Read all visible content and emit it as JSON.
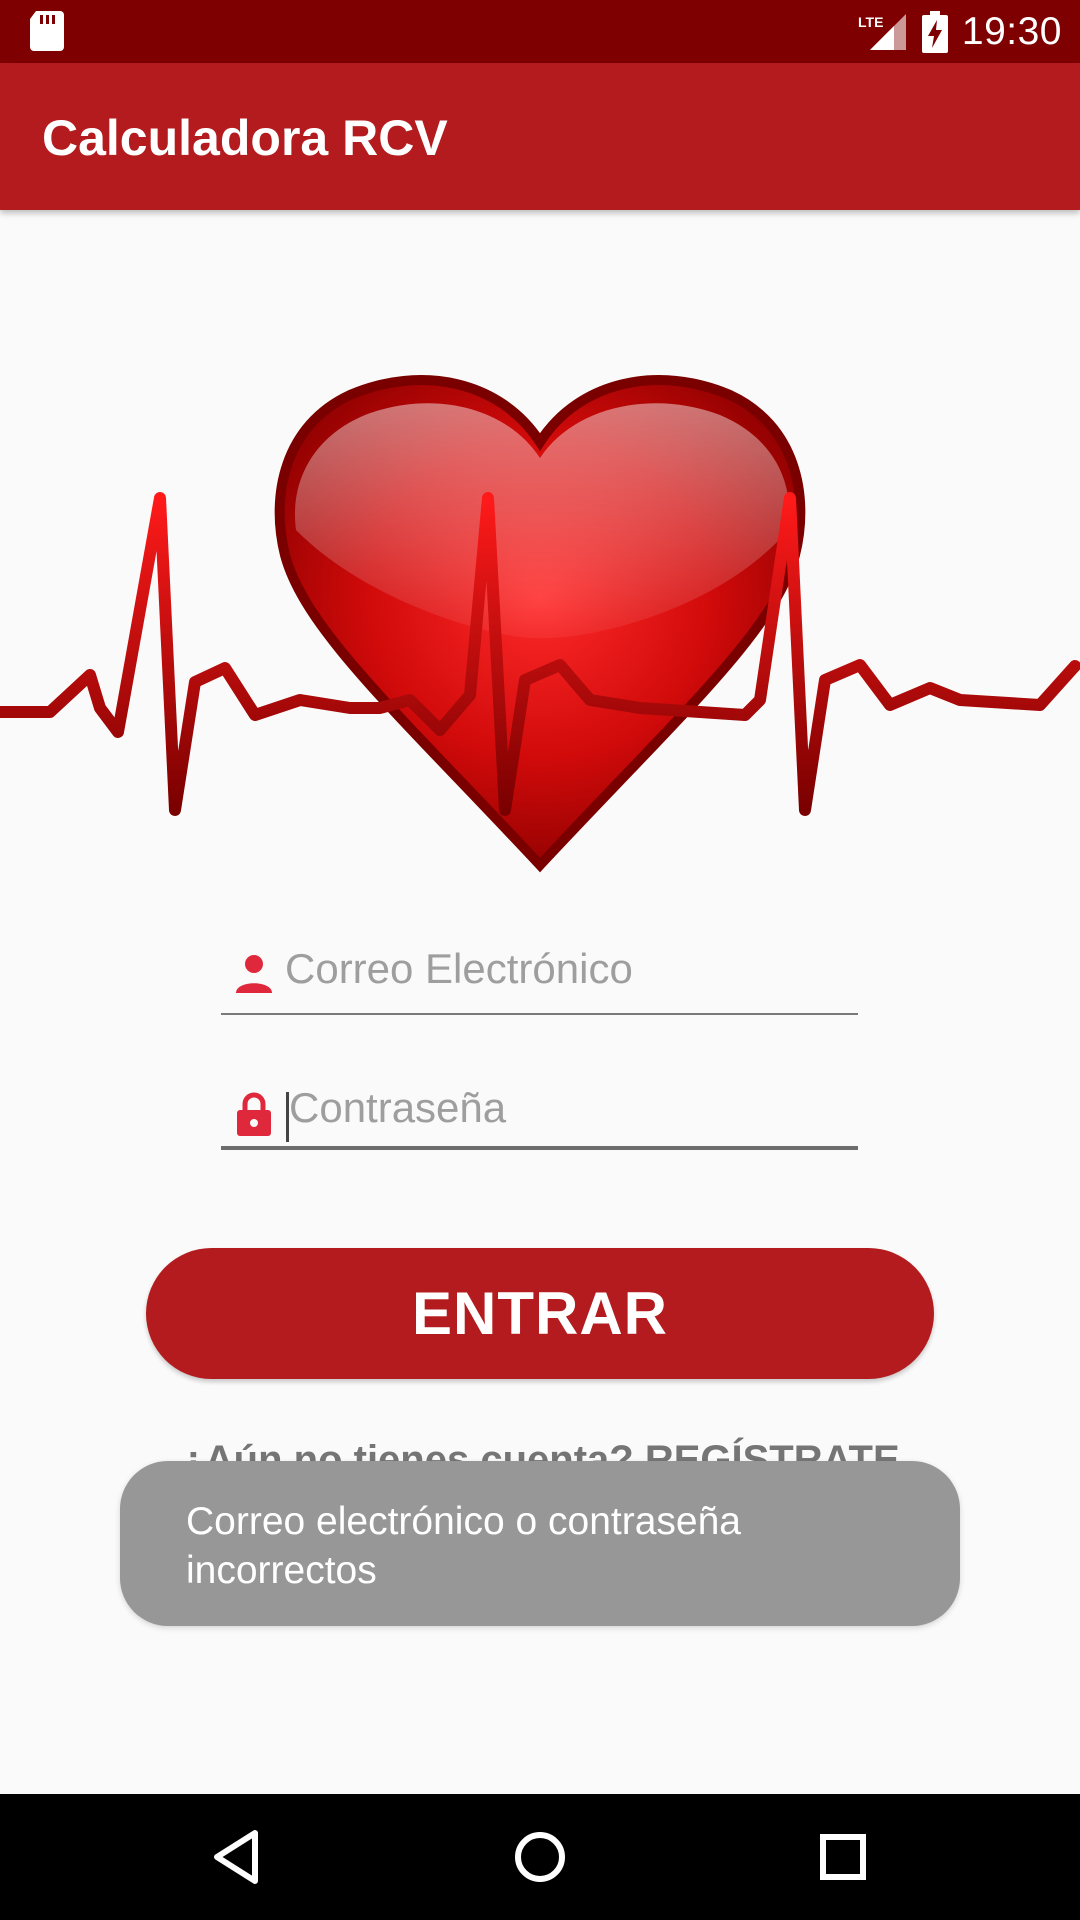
{
  "status_bar": {
    "time": "19:30",
    "network": "LTE",
    "icons": [
      "sd-card-icon",
      "lte-signal-icon",
      "battery-charging-icon"
    ]
  },
  "app_bar": {
    "title": "Calculadora RCV",
    "color": "#b31b1e"
  },
  "hero": {
    "image": "heart-ekg-icon"
  },
  "login_form": {
    "email": {
      "placeholder": "Correo Electrónico",
      "value": "",
      "icon": "person-icon"
    },
    "password": {
      "placeholder": "Contraseña",
      "value": "",
      "icon": "lock-icon"
    },
    "submit_label": "ENTRAR",
    "register_prompt": "¿Aún no tienes cuenta? REGÍSTRATE"
  },
  "toast": {
    "message": "Correo electrónico o contraseña incorrectos"
  },
  "nav_bar": {
    "buttons": [
      "back-icon",
      "home-icon",
      "recents-icon"
    ]
  },
  "colors": {
    "status_bar": "#7f0000",
    "primary": "#b31b1e",
    "accent_icon": "#e0283c",
    "toast": "#979797"
  }
}
